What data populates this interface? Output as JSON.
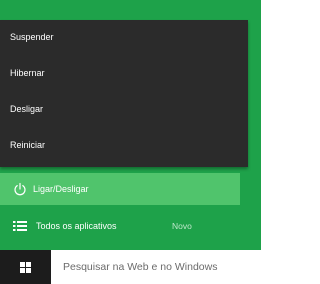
{
  "power_menu": {
    "items": [
      {
        "label": "Suspender"
      },
      {
        "label": "Hibernar"
      },
      {
        "label": "Desligar"
      },
      {
        "label": "Reiniciar"
      }
    ]
  },
  "start": {
    "power_label": "Ligar/Desligar",
    "all_apps_label": "Todos os aplicativos",
    "all_apps_badge": "Novo",
    "accent_color": "#1ea24a",
    "hover_color": "#50c46c",
    "menu_color": "#2b2b2b"
  },
  "taskbar": {
    "search_placeholder": "Pesquisar na Web e no Windows",
    "start_icon": "windows-logo-icon"
  }
}
